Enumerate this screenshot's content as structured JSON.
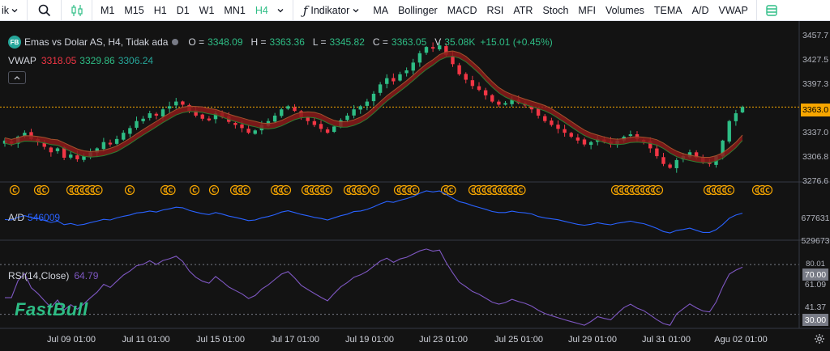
{
  "toolbar": {
    "symbol_stub": "ik",
    "timeframes": [
      "M1",
      "M15",
      "H1",
      "D1",
      "W1",
      "MN1",
      "H4"
    ],
    "active_timeframe": "H4",
    "indicator_button": "Indikator",
    "indicators": [
      "MA",
      "Bollinger",
      "MACD",
      "RSI",
      "ATR",
      "Stoch",
      "MFI",
      "Volumes",
      "TEMA",
      "A/D",
      "VWAP"
    ]
  },
  "legend": {
    "symbol_badge": "FB",
    "title": "Emas vs Dolar AS, H4, Tidak ada",
    "open_key": "O =",
    "open": "3348.09",
    "high_key": "H =",
    "high": "3363.36",
    "low_key": "L =",
    "low": "3345.82",
    "close_key": "C =",
    "close": "3363.05",
    "volume_key": "V",
    "volume": "35.08K",
    "change": "+15.01 (+0.45%)"
  },
  "vwap": {
    "label": "VWAP",
    "v1": "3318.05",
    "v2": "3329.86",
    "v3": "3306.24"
  },
  "ad": {
    "label": "A/D",
    "value": "546009"
  },
  "rsi": {
    "label": "RSI(14,Close)",
    "value": "64.79"
  },
  "price_axis": {
    "labels": [
      "3457.7",
      "3427.5",
      "3397.3",
      "3337.0",
      "3306.8",
      "3276.6"
    ],
    "current": "3363.0"
  },
  "ad_axis": {
    "labels": [
      "677631",
      "529673"
    ]
  },
  "rsi_axis": {
    "top": "80.01",
    "upper": "70.00",
    "mid": "61.09",
    "low": "41.37",
    "lower": "30.00"
  },
  "time_axis": [
    "Jul 09 01:00",
    "Jul 11 01:00",
    "Jul 15 01:00",
    "Jul 17 01:00",
    "Jul 19 01:00",
    "Jul 23 01:00",
    "Jul 25 01:00",
    "Jul 29 01:00",
    "Jul 31 01:00",
    "Agu 02 01:00"
  ],
  "watermark": "FastBull",
  "event_marker_letter": "C",
  "colors": {
    "up": "#2ebd85",
    "down": "#f23645",
    "accent": "#f7a600",
    "ad_line": "#2962ff",
    "rsi_line": "#7e57c2"
  },
  "chart_data": {
    "type": "candlestick",
    "x_range": [
      "Jul 08",
      "Agu 02"
    ],
    "y_range": [
      3270,
      3465
    ],
    "close_series_approx": [
      3320,
      3316,
      3325,
      3330,
      3322,
      3318,
      3312,
      3305,
      3310,
      3298,
      3302,
      3296,
      3300,
      3305,
      3310,
      3318,
      3315,
      3322,
      3330,
      3336,
      3345,
      3348,
      3355,
      3352,
      3360,
      3364,
      3370,
      3366,
      3358,
      3352,
      3348,
      3346,
      3355,
      3350,
      3344,
      3340,
      3336,
      3330,
      3333,
      3340,
      3345,
      3352,
      3360,
      3364,
      3358,
      3350,
      3345,
      3340,
      3335,
      3330,
      3338,
      3346,
      3352,
      3360,
      3364,
      3370,
      3380,
      3392,
      3400,
      3396,
      3405,
      3410,
      3420,
      3432,
      3440,
      3438,
      3442,
      3430,
      3418,
      3405,
      3398,
      3390,
      3385,
      3378,
      3370,
      3366,
      3368,
      3372,
      3368,
      3365,
      3360,
      3352,
      3345,
      3340,
      3335,
      3330,
      3325,
      3320,
      3315,
      3318,
      3322,
      3318,
      3315,
      3320,
      3325,
      3328,
      3322,
      3318,
      3310,
      3300,
      3290,
      3285,
      3295,
      3300,
      3305,
      3298,
      3292,
      3290,
      3300,
      3320,
      3345,
      3355,
      3363
    ],
    "ad_range": [
      440000,
      700000
    ],
    "rsi_range": [
      20,
      85
    ],
    "rsi_levels": [
      30,
      70
    ]
  }
}
